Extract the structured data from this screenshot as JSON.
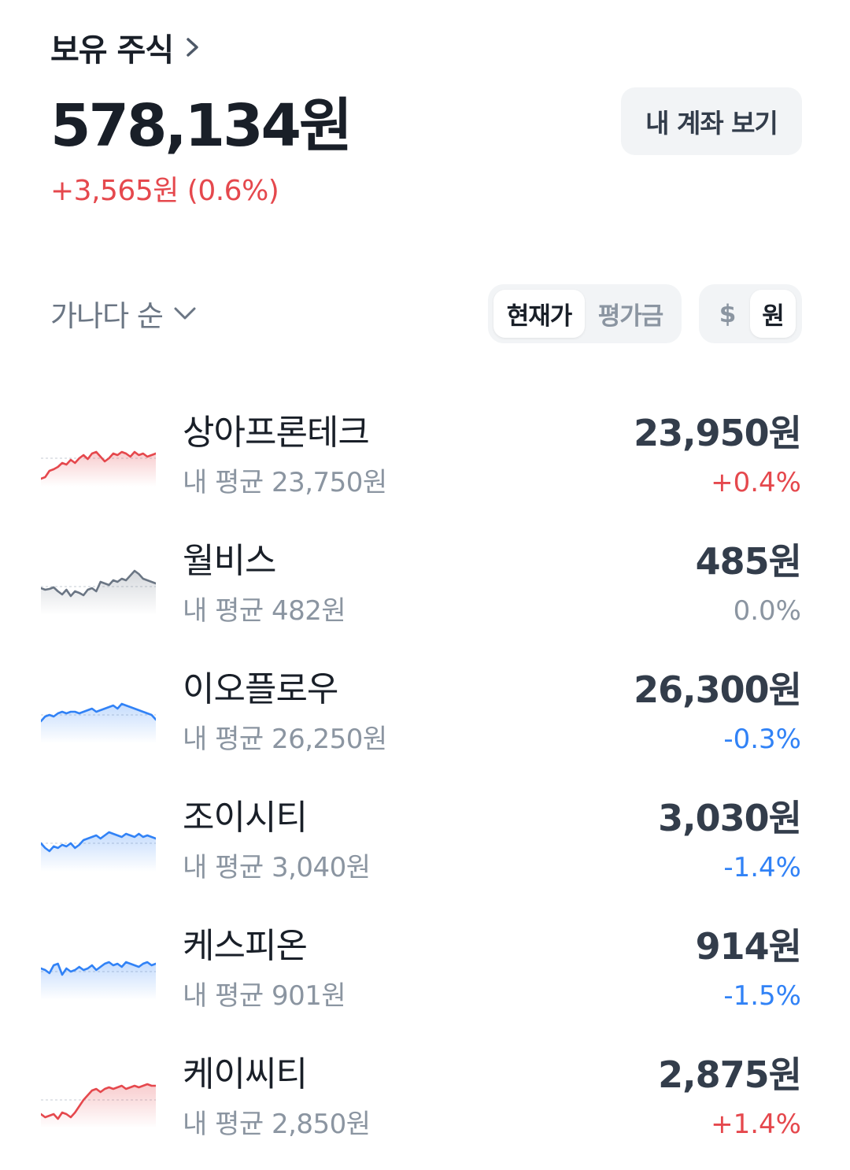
{
  "header": {
    "title": "보유 주식",
    "total": "578,134원",
    "change": "+3,565원 (0.6%)",
    "account_button": "내 계좌 보기"
  },
  "controls": {
    "sort_label": "가나다 순",
    "price_modes": [
      "현재가",
      "평가금"
    ],
    "price_mode_selected": "현재가",
    "currency_modes": [
      "$",
      "원"
    ],
    "currency_selected": "원"
  },
  "colors": {
    "up": "#e5484d",
    "down": "#3182f6",
    "flat": "#6b7684"
  },
  "stocks": [
    {
      "name": "상아프론테크",
      "avg": "내 평균 23,750원",
      "price": "23,950원",
      "change": "+0.4%",
      "trend": "up"
    },
    {
      "name": "월비스",
      "avg": "내 평균 482원",
      "price": "485원",
      "change": "0.0%",
      "trend": "flat"
    },
    {
      "name": "이오플로우",
      "avg": "내 평균 26,250원",
      "price": "26,300원",
      "change": "-0.3%",
      "trend": "down"
    },
    {
      "name": "조이시티",
      "avg": "내 평균 3,040원",
      "price": "3,030원",
      "change": "-1.4%",
      "trend": "down"
    },
    {
      "name": "케스피온",
      "avg": "내 평균 901원",
      "price": "914원",
      "change": "-1.5%",
      "trend": "down"
    },
    {
      "name": "케이씨티",
      "avg": "내 평균 2,850원",
      "price": "2,875원",
      "change": "+1.4%",
      "trend": "up"
    }
  ]
}
